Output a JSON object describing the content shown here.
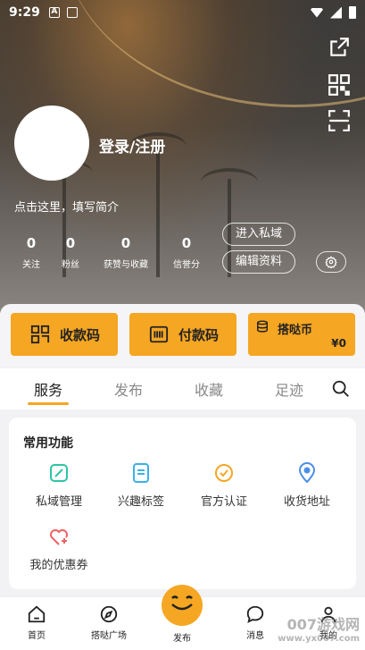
{
  "status_bar": {
    "time": "9:29"
  },
  "profile": {
    "login_label": "登录/注册",
    "bio_prompt": "点击这里，填写简介",
    "stats": [
      {
        "value": "0",
        "label": "关注"
      },
      {
        "value": "0",
        "label": "粉丝"
      },
      {
        "value": "0",
        "label": "获赞与收藏"
      },
      {
        "value": "0",
        "label": "信誉分"
      }
    ],
    "enter_private_label": "进入私域",
    "edit_profile_label": "编辑资料"
  },
  "wallet": {
    "receive_label": "收款码",
    "pay_label": "付款码",
    "coin_label": "搭哒币",
    "coin_value": "¥0"
  },
  "tabs": [
    {
      "label": "服务",
      "active": true
    },
    {
      "label": "发布",
      "active": false
    },
    {
      "label": "收藏",
      "active": false
    },
    {
      "label": "足迹",
      "active": false
    }
  ],
  "common_functions": {
    "title": "常用功能",
    "items": [
      {
        "label": "私域管理",
        "icon": "edit-square-icon",
        "color": "#2ec4a6"
      },
      {
        "label": "兴趣标签",
        "icon": "document-icon",
        "color": "#3ab0e8"
      },
      {
        "label": "官方认证",
        "icon": "check-badge-icon",
        "color": "#f5a623"
      },
      {
        "label": "收货地址",
        "icon": "location-icon",
        "color": "#4a8fe7"
      },
      {
        "label": "我的优惠券",
        "icon": "heart-plus-icon",
        "color": "#f06060"
      }
    ]
  },
  "bottom_nav": [
    {
      "label": "首页",
      "icon": "home-icon"
    },
    {
      "label": "搭哒广场",
      "icon": "compass-icon"
    },
    {
      "label": "发布",
      "icon": "publish-face-icon"
    },
    {
      "label": "消息",
      "icon": "chat-icon"
    },
    {
      "label": "我的",
      "icon": "person-icon"
    }
  ],
  "watermark": {
    "brand": "007游戏网",
    "url": "www.yx007.com"
  },
  "colors": {
    "accent": "#f5a623",
    "background": "#f2f2f4"
  }
}
